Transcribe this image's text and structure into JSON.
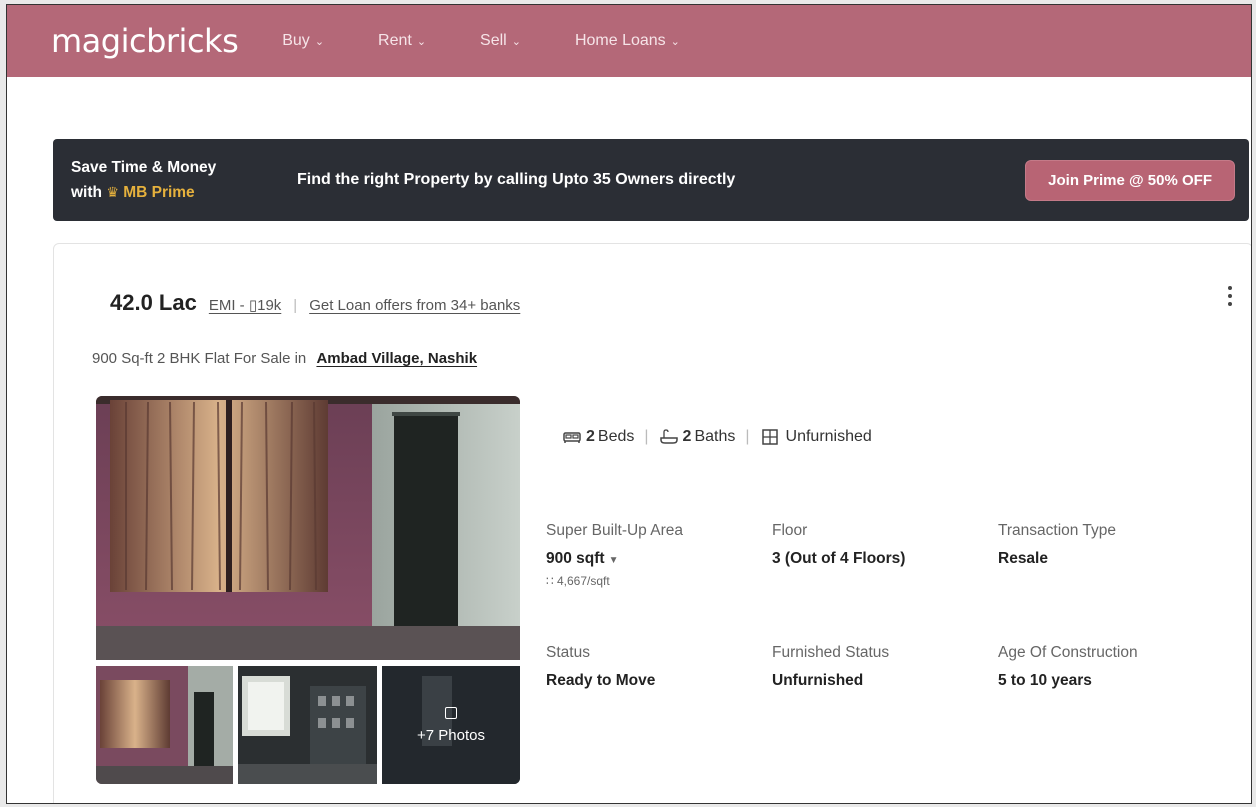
{
  "header": {
    "logo": "magicbricks",
    "nav": [
      {
        "label": "Buy"
      },
      {
        "label": "Rent"
      },
      {
        "label": "Sell"
      },
      {
        "label": "Home Loans"
      }
    ]
  },
  "prime_banner": {
    "line1": "Save Time & Money",
    "line2_prefix": "with",
    "brand": "MB Prime",
    "message": "Find the right Property by calling Upto 35 Owners directly",
    "cta": "Join Prime @ 50% OFF"
  },
  "listing": {
    "price": "42.0 Lac",
    "emi_link": "EMI - ▯19k",
    "loan_link": "Get Loan offers from 34+ banks",
    "subtitle": "900 Sq-ft 2 BHK Flat For Sale in",
    "location": "Ambad Village, Nashik",
    "features": {
      "beds_count": "2",
      "beds_label": "Beds",
      "baths_count": "2",
      "baths_label": "Baths",
      "furnishing": "Unfurnished"
    },
    "details": {
      "area_label": "Super Built-Up Area",
      "area_value": "900 sqft",
      "area_rate": "∷ 4,667/sqft",
      "floor_label": "Floor",
      "floor_value": "3 (Out of 4 Floors)",
      "transaction_label": "Transaction Type",
      "transaction_value": "Resale",
      "status_label": "Status",
      "status_value": "Ready to Move",
      "furnished_label": "Furnished Status",
      "furnished_value": "Unfurnished",
      "age_label": "Age Of Construction",
      "age_value": "5 to 10 years"
    },
    "more_photos": "+7 Photos"
  },
  "colors": {
    "header_bg": "#b46878",
    "banner_bg": "#2b2e35",
    "cta_bg": "#b86474",
    "prime_gold": "#e6b13d"
  }
}
